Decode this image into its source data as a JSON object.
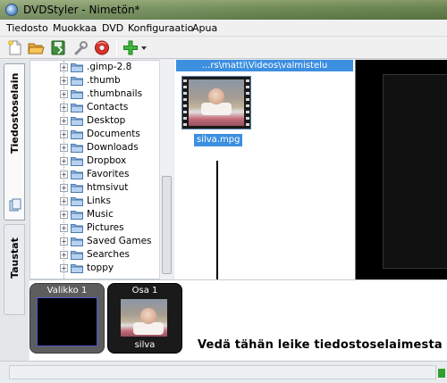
{
  "window": {
    "title": "DVDStyler - Nimetön*"
  },
  "menu": {
    "items": [
      "Tiedosto",
      "Muokkaa",
      "DVD",
      "Konfiguraatio",
      "Apua"
    ]
  },
  "toolbar": {
    "buttons": [
      {
        "name": "new-project",
        "icon": "new-document-icon"
      },
      {
        "name": "open-project",
        "icon": "open-folder-icon"
      },
      {
        "name": "save-project",
        "icon": "save-icon"
      },
      {
        "name": "settings",
        "icon": "wrench-icon"
      },
      {
        "name": "burn",
        "icon": "burn-disc-icon"
      },
      {
        "name": "add",
        "icon": "add-plus-icon"
      }
    ]
  },
  "left_tabs": [
    {
      "label": "Tiedostoselain",
      "active": true
    },
    {
      "label": "Taustat",
      "active": false
    }
  ],
  "file_tree": {
    "folders": [
      ".gimp-2.8",
      ".thumb",
      ".thumbnails",
      "Contacts",
      "Desktop",
      "Documents",
      "Downloads",
      "Dropbox",
      "Favorites",
      "htmsivut",
      "Links",
      "Music",
      "Pictures",
      "Saved Games",
      "Searches",
      "toppy"
    ]
  },
  "browser": {
    "path": "...rs\\matti\\Videos\\valmistelu",
    "files": [
      {
        "name": "silva.mpg",
        "selected": true
      }
    ]
  },
  "titleset": {
    "menu_card": {
      "title": "Valikko 1"
    },
    "title_card": {
      "title": "Osa 1",
      "caption": "silva"
    },
    "hint": "Vedä tähän leike tiedostoselaimesta"
  },
  "colors": {
    "selection": "#3d8fe0",
    "menu_border": "#4b5bd1"
  }
}
